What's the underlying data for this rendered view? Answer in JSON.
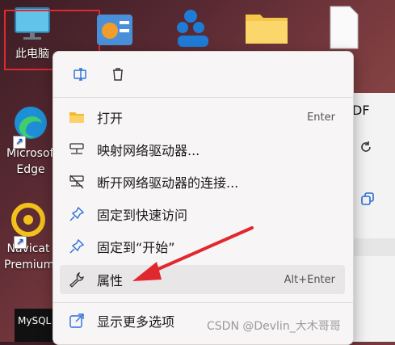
{
  "desktop": {
    "this_pc_label": "此电脑",
    "edge_label": "Microsoft Edge",
    "navicat_label": "Navicat Premium",
    "mysql_label": "MySQL"
  },
  "right_window": {
    "top_text": "DF"
  },
  "menu": {
    "items": [
      {
        "label": "打开",
        "shortcut": "Enter",
        "icon": "folder-icon"
      },
      {
        "label": "映射网络驱动器...",
        "shortcut": "",
        "icon": "network-drive-icon"
      },
      {
        "label": "断开网络驱动器的连接...",
        "shortcut": "",
        "icon": "network-drive-disconnect-icon"
      },
      {
        "label": "固定到快速访问",
        "shortcut": "",
        "icon": "pin-icon"
      },
      {
        "label": "固定到“开始”",
        "shortcut": "",
        "icon": "pin-icon"
      },
      {
        "label": "属性",
        "shortcut": "Alt+Enter",
        "icon": "wrench-icon"
      },
      {
        "label": "显示更多选项",
        "shortcut": "",
        "icon": "open-external-icon"
      }
    ]
  },
  "watermark": "CSDN @Devlin_大木哥哥",
  "colors": {
    "highlight_box": "#e0282e",
    "arrow": "#e0282e"
  }
}
